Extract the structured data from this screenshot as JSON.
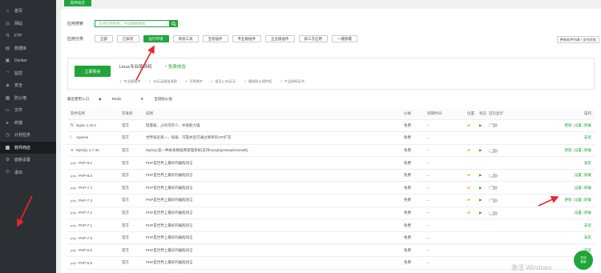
{
  "sidebar": {
    "items": [
      {
        "label": "首页",
        "icon": "home-icon",
        "glyph": "⌂"
      },
      {
        "label": "网站",
        "icon": "globe-icon",
        "glyph": "◎"
      },
      {
        "label": "FTP",
        "icon": "ftp-icon",
        "glyph": "⇅"
      },
      {
        "label": "数据库",
        "icon": "database-icon",
        "glyph": "▤"
      },
      {
        "label": "Docker",
        "icon": "docker-icon",
        "glyph": "▣"
      },
      {
        "label": "监控",
        "icon": "monitor-icon",
        "glyph": "◔"
      },
      {
        "label": "安全",
        "icon": "shield-icon",
        "glyph": "◈"
      },
      {
        "label": "防火墙",
        "icon": "firewall-icon",
        "glyph": "▦"
      },
      {
        "label": "文件",
        "icon": "folder-icon",
        "glyph": "▭"
      },
      {
        "label": "终端",
        "icon": "terminal-icon",
        "glyph": "▸"
      },
      {
        "label": "计划任务",
        "icon": "clock-icon",
        "glyph": "◷"
      },
      {
        "label": "软件商店",
        "icon": "store-icon",
        "glyph": "▩"
      },
      {
        "label": "面板设置",
        "icon": "gear-icon",
        "glyph": "⚙"
      },
      {
        "label": "退出",
        "icon": "logout-icon",
        "glyph": "⏻"
      }
    ]
  },
  "breadcrumb": "软件商店",
  "search": {
    "label": "应用搜索",
    "placeholder": "支持应用名称、字段模糊搜索"
  },
  "categories": {
    "label": "应用分类",
    "items": [
      "全部",
      "已安装",
      "运行环境",
      "系统工具",
      "宝塔插件",
      "专业版插件",
      "企业版插件",
      "第三方应用",
      "一键部署"
    ],
    "active_index": 2
  },
  "update_list_label": "更新软件列表 / 支付状态",
  "banner": {
    "buy_label": "立即购买",
    "title": "Linux专业版特权",
    "sub": "免费体验",
    "features": [
      "专业版插件",
      "15天无理由退款",
      "可更换IP",
      "低至1.18元/天",
      "模拟防火墙特权",
      "产品授权证书"
    ]
  },
  "recent": {
    "label": "最近使用入口",
    "items": [
      "Redis",
      "宝塔防火墙"
    ]
  },
  "table": {
    "headers": [
      "软件名称",
      "开发商",
      "说明",
      "价格",
      "到期时间",
      "位置",
      "状态",
      "首页显示",
      "操作"
    ],
    "rows": [
      {
        "name": "Nginx 1.20.1",
        "icon": "nginx-icon",
        "glyph": "N",
        "dev": "官方",
        "desc": "轻量级，占有内存少，并发能力强",
        "price": "免费",
        "exp": "--",
        "pos": true,
        "state": true,
        "ops": [
          "更新",
          "设置",
          "卸载"
        ]
      },
      {
        "name": "Apache",
        "icon": "apache-icon",
        "glyph": "⁄",
        "dev": "官方",
        "desc": "世界排名第一，快速、可靠并且可通过简单的API扩充",
        "price": "免费",
        "exp": "--",
        "pos": false,
        "state": false,
        "ops": [
          "安装"
        ]
      },
      {
        "name": "MySQL 5.7.34",
        "icon": "mysql-icon",
        "glyph": "≋",
        "dev": "官方",
        "desc": "MySQL是一种关系数据库管理系统(支持mysql/greatsql/mariadb)",
        "price": "免费",
        "exp": "--",
        "pos": true,
        "state": true,
        "ops": [
          "更新",
          "设置",
          "卸载"
        ]
      },
      {
        "name": "PHP-8.1",
        "icon": "php-icon",
        "glyph": "php",
        "dev": "官方",
        "desc": "PHP是世界上最好的编程语言",
        "price": "免费",
        "exp": "--",
        "pos": false,
        "state": false,
        "ops": [
          "安装"
        ]
      },
      {
        "name": "PHP-8.0",
        "icon": "php-icon",
        "glyph": "php",
        "dev": "官方",
        "desc": "PHP是世界上最好的编程语言",
        "price": "免费",
        "exp": "--",
        "pos": true,
        "state": true,
        "ops": [
          "设置",
          "卸载"
        ]
      },
      {
        "name": "PHP-7.4",
        "icon": "php-icon",
        "glyph": "php",
        "dev": "官方",
        "desc": "PHP是世界上最好的编程语言",
        "price": "免费",
        "exp": "--",
        "pos": true,
        "state": true,
        "ops": [
          "设置",
          "卸载"
        ]
      },
      {
        "name": "PHP-7.3",
        "icon": "php-icon",
        "glyph": "php",
        "dev": "官方",
        "desc": "PHP是世界上最好的编程语言",
        "price": "免费",
        "exp": "--",
        "pos": true,
        "state": true,
        "ops": [
          "更新",
          "设置",
          "卸载"
        ]
      },
      {
        "name": "PHP-7.2",
        "icon": "php-icon",
        "glyph": "php",
        "dev": "官方",
        "desc": "PHP是世界上最好的编程语言",
        "price": "免费",
        "exp": "--",
        "pos": true,
        "state": true,
        "ops": [
          "设置",
          "卸载"
        ]
      },
      {
        "name": "PHP-7.1",
        "icon": "php-icon",
        "glyph": "php",
        "dev": "官方",
        "desc": "PHP是世界上最好的编程语言",
        "price": "免费",
        "exp": "--",
        "pos": false,
        "state": false,
        "ops": [
          "安装"
        ]
      },
      {
        "name": "PHP-7.0",
        "icon": "php-icon",
        "glyph": "php",
        "dev": "官方",
        "desc": "PHP是世界上最好的编程语言",
        "price": "免费",
        "exp": "--",
        "pos": false,
        "state": false,
        "ops": [
          "安装"
        ]
      },
      {
        "name": "PHP-5.6",
        "icon": "php-icon",
        "glyph": "php",
        "dev": "官方",
        "desc": "PHP是世界上最好的编程语言",
        "price": "免费",
        "exp": "--",
        "pos": false,
        "state": false,
        "ops": [
          "安装"
        ]
      },
      {
        "name": "PHP-5.5",
        "icon": "php-icon",
        "glyph": "php",
        "dev": "官方",
        "desc": "PHP是世界上最好的编程语言",
        "price": "免费",
        "exp": "--",
        "pos": false,
        "state": false,
        "ops": [
          "安装"
        ]
      },
      {
        "name": "PHP-5.4",
        "icon": "php-icon",
        "glyph": "php",
        "dev": "官方",
        "desc": "PHP是世界上最好的编程语言",
        "price": "免费",
        "exp": "--",
        "pos": false,
        "state": false,
        "ops": [
          "安装"
        ]
      }
    ]
  },
  "help": {
    "line1": "在线",
    "line2": "客服"
  },
  "watermark": "激活 Windows",
  "colors": {
    "accent": "#20a53a",
    "sidebar_bg": "#2c3035",
    "arrow": "#e8262b"
  }
}
